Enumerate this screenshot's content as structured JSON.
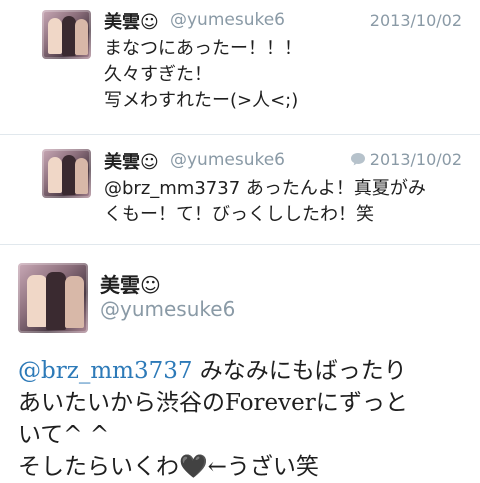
{
  "tweets": [
    {
      "name": "美雲☺",
      "handle": "@yumesuke6",
      "date": "2013/10/02",
      "text": "まなつにあったー！！！\n久々すぎた！\n写メわすれたー(>人<;)"
    },
    {
      "name": "美雲☺",
      "handle": "@yumesuke6",
      "date": "2013/10/02",
      "icon": "reply-bubble-icon",
      "text": "@brz_mm3737 あったんよ！真夏がみ\nくもー！て！びっくししたわ！笑"
    },
    {
      "name": "美雲☺",
      "handle": "@yumesuke6",
      "mention": "@brz_mm3737",
      "text_after_mention": " みなみにもばったり\nあいたいから渋谷のForeverにずっと\nいて^ ^\nそしたらいくわ🖤←うざい笑"
    }
  ],
  "colors": {
    "handle": "#8a9aa6",
    "mention": "#2d7ab8",
    "divider": "#e1e8ed"
  }
}
